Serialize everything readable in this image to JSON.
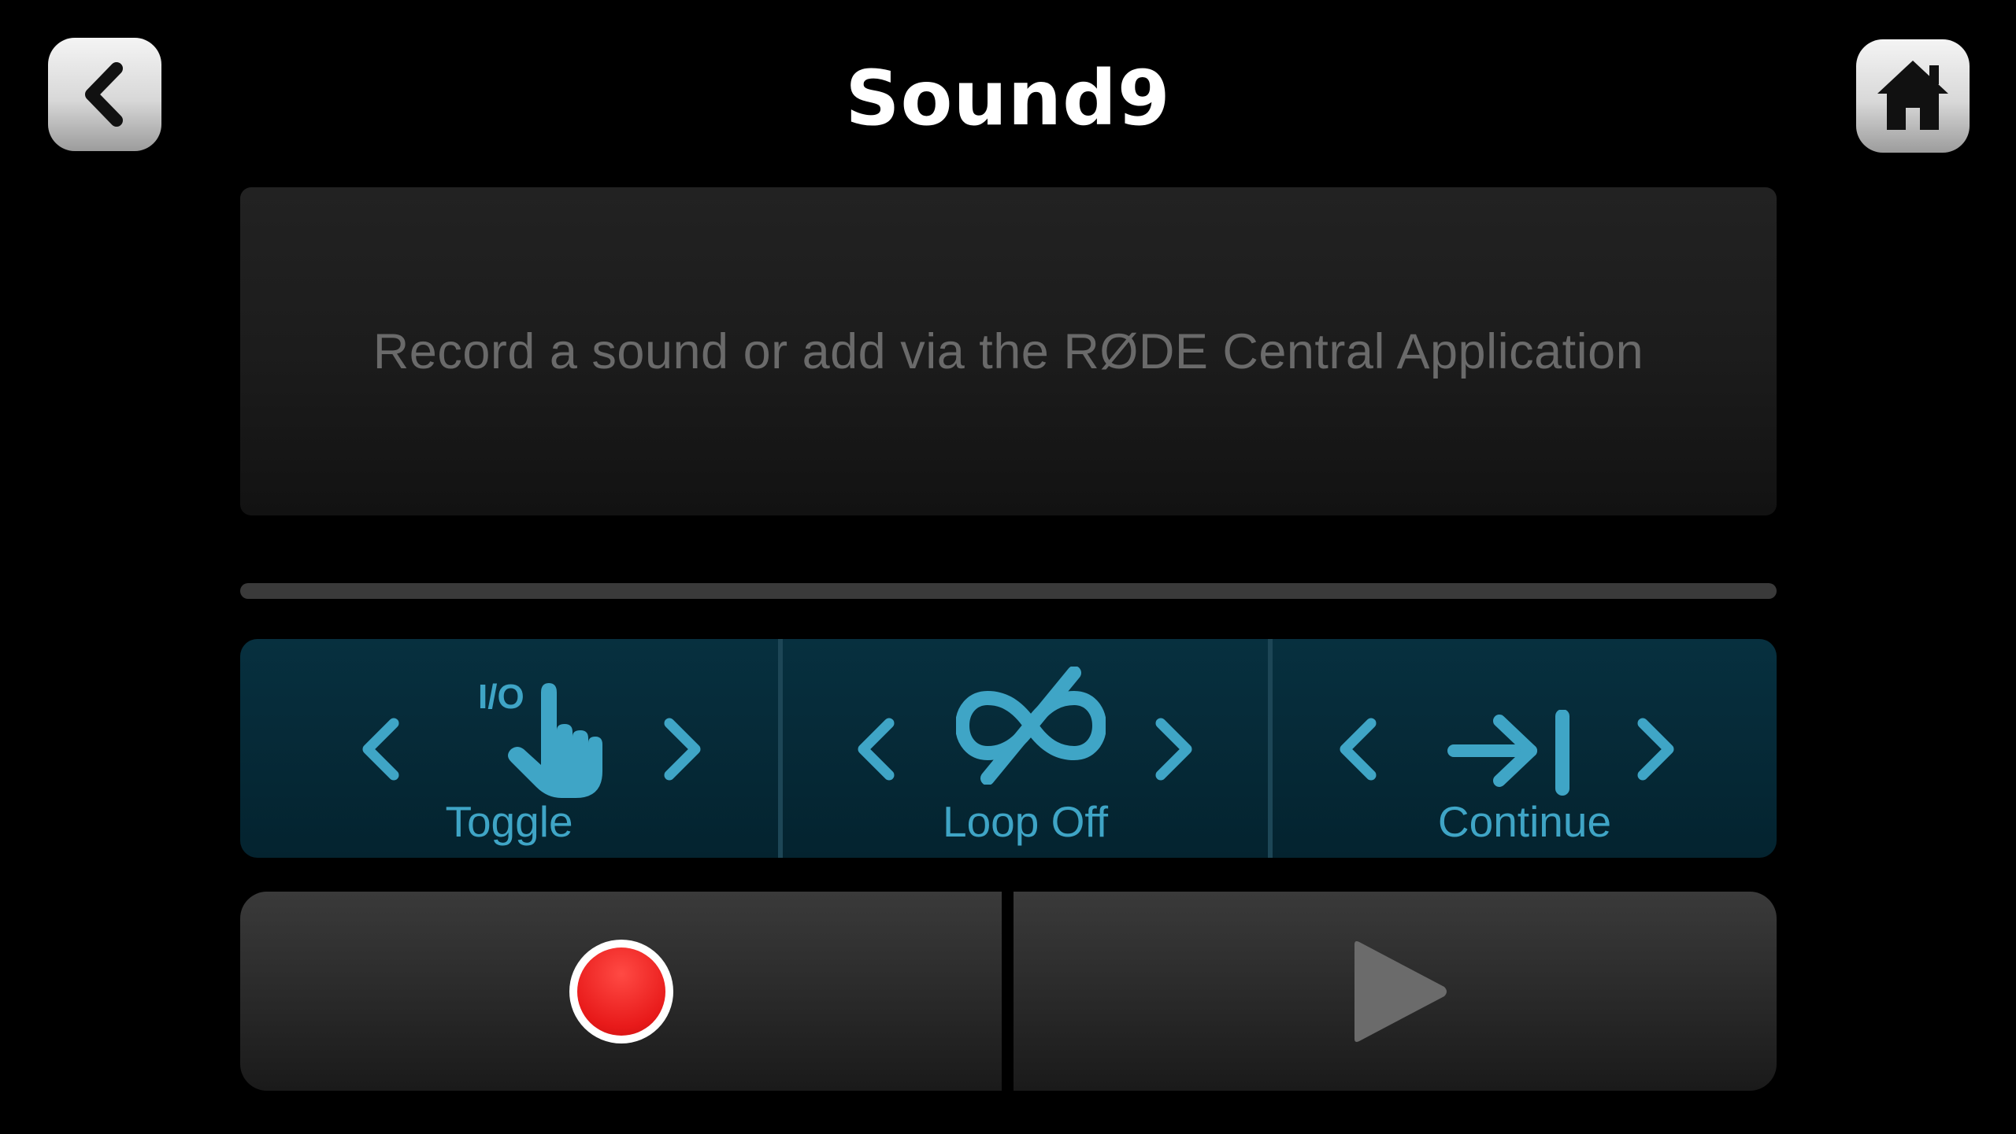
{
  "header": {
    "title": "Sound9",
    "back_icon": "chevron-left-icon",
    "home_icon": "home-icon"
  },
  "info": {
    "message": "Record a sound or add via the RØDE Central Application"
  },
  "progress": {
    "value": 0
  },
  "modes": {
    "trigger": {
      "label": "Toggle",
      "badge": "I/O",
      "icon": "tap-finger-icon"
    },
    "loop": {
      "label": "Loop Off",
      "icon": "loop-off-icon"
    },
    "end": {
      "label": "Continue",
      "icon": "arrow-to-bar-icon"
    }
  },
  "transport": {
    "record_icon": "record-icon",
    "play_icon": "play-icon"
  },
  "colors": {
    "accent": "#3fa5c6",
    "mode_bar_bg": "#04232f",
    "record": "#e81a1a",
    "play_disabled": "#6b6b6b",
    "info_text": "#6a6a6a"
  }
}
